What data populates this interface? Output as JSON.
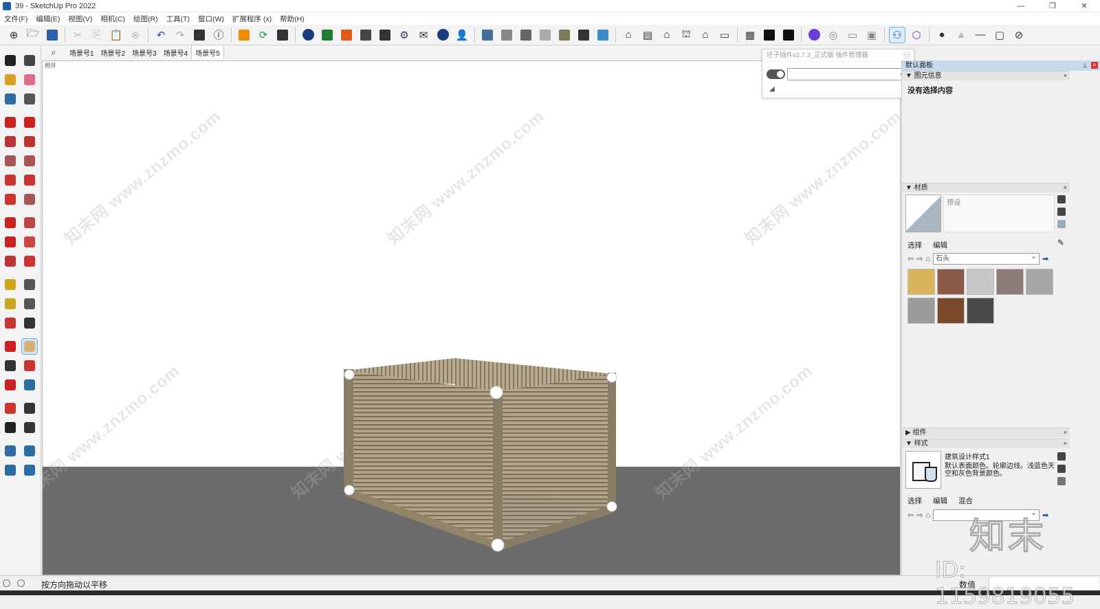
{
  "window": {
    "title": "39 - SketchUp Pro 2022",
    "controls": [
      "—",
      "❐",
      "✕"
    ]
  },
  "menu": [
    "文件(F)",
    "编辑(E)",
    "视图(V)",
    "相机(C)",
    "绘图(R)",
    "工具(T)",
    "窗口(W)",
    "扩展程序 (x)",
    "帮助(H)"
  ],
  "scenes": {
    "tabs": [
      "场景号1",
      "场景号2",
      "场景号3",
      "场景号4",
      "场景号5"
    ],
    "active_index": 4
  },
  "viewport": {
    "label": "相邻",
    "watermark": "知末网 www.znzmo.com",
    "sky_color": "#ffffff",
    "ground_color": "#6b6b6b"
  },
  "plugin": {
    "title": "坯子插件v2.7.3_正式版 插件管理器",
    "search_value": ""
  },
  "tray": {
    "title": "默认面板",
    "entity_info": {
      "label": "图元信息",
      "empty_text": "没有选择内容"
    },
    "materials": {
      "label": "材质",
      "name_value": "预设",
      "tab_select": "选择",
      "tab_edit": "编辑",
      "library": "石头",
      "swatch_colors": [
        "#d9b45a",
        "#8a5a48",
        "#c8c8c8",
        "#8b7b78",
        "#a6a6a6",
        "#9b9b9b",
        "#7a4a2a",
        "#4a4a4a"
      ]
    },
    "components": {
      "label": "组件"
    },
    "styles": {
      "label": "样式",
      "name": "建筑设计样式1",
      "description": "默认表面颜色。轮廓边线。浅蓝色天空和灰色背景颜色。",
      "tab_select": "选择",
      "tab_edit": "编辑",
      "tab_mix": "混合"
    }
  },
  "status": {
    "hint": "按方向拖动以平移",
    "measurements_label": "数值",
    "measurements_value": ""
  },
  "overlay": {
    "logo_text": "知末",
    "id_text": "ID: 1159819055"
  }
}
